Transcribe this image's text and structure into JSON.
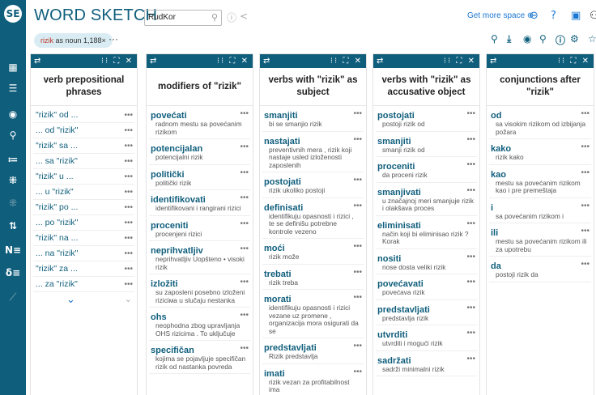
{
  "app": {
    "title": "WORD SKETCH",
    "corpus": "RudKor",
    "get_more_space": "Get more space",
    "query_keyword": "rizik",
    "query_rest": " as noun 1,188×",
    "more_dots": "···"
  },
  "columns": [
    {
      "title": "verb prepositional phrases",
      "rows": [
        "\"rizik\" od ...",
        "... od \"rizik\"",
        "\"rizik\" sa ...",
        "... sa \"rizik\"",
        "\"rizik\" u ...",
        "... u \"rizik\"",
        "\"rizik\" po ...",
        "... po \"rizik\"",
        "\"rizik\" na ...",
        "... na \"rizik\"",
        "\"rizik\" za ...",
        "... za \"rizik\""
      ]
    },
    {
      "title": "modifiers of \"rizik\"",
      "items": [
        {
          "word": "povećati",
          "example": "radnom mestu sa povećanim rizikom"
        },
        {
          "word": "potencijalan",
          "example": "potencijalni rizik"
        },
        {
          "word": "politički",
          "example": "politički rizik"
        },
        {
          "word": "identifikovati",
          "example": "identifikovani i rangirani rizici"
        },
        {
          "word": "proceniti",
          "example": "procenjeni rizici"
        },
        {
          "word": "neprihvatljiv",
          "example": "neprihvatljiv Uopšteno • visoki rizik"
        },
        {
          "word": "izložiti",
          "example": "su zaposleni posebno izloženi riziciма u slučaju nestanka"
        },
        {
          "word": "ohs",
          "example": "neophodna zbog upravljanja OHS rizicima . To uključuje"
        },
        {
          "word": "specifičan",
          "example": "kojima se pojavljuje specifičan rizik od nastanka povreda"
        }
      ]
    },
    {
      "title": "verbs with \"rizik\" as subject",
      "items": [
        {
          "word": "smanjiti",
          "example": "bi se smanjio rizik"
        },
        {
          "word": "nastajati",
          "example": "preventivnih mera , rizik koji nastaje usled izloženosti zaposlenih"
        },
        {
          "word": "postojati",
          "example": "rizik ukoliko postoji"
        },
        {
          "word": "definisati",
          "example": "identifikuju opasnosti i rizici , te se definišu potrebne kontrole vezeno"
        },
        {
          "word": "moći",
          "example": "rizik može"
        },
        {
          "word": "trebati",
          "example": "rizik treba"
        },
        {
          "word": "morati",
          "example": "identifikuju opasnosti i rizici vezane uz promene , organizacija mora osigurati da se"
        },
        {
          "word": "predstavljati",
          "example": "Rizik predstavlja"
        },
        {
          "word": "imati",
          "example": "rizik vezan za profitabilnost ima"
        }
      ]
    },
    {
      "title": "verbs with \"rizik\" as accusative object",
      "items": [
        {
          "word": "postojati",
          "example": "postoji rizik od"
        },
        {
          "word": "smanjiti",
          "example": "smanji rizik od"
        },
        {
          "word": "proceniti",
          "example": "da proceni rizik"
        },
        {
          "word": "smanjivati",
          "example": "u značajnoj meri smanjuje rizik i olakšava proces"
        },
        {
          "word": "eliminisati",
          "example": "način koji bi eliminisao rizik ? Korak"
        },
        {
          "word": "nositi",
          "example": "nose dosta veliki rizik"
        },
        {
          "word": "povećavati",
          "example": "povećava rizik"
        },
        {
          "word": "predstavljati",
          "example": "predstavlja rizik"
        },
        {
          "word": "utvrditi",
          "example": "utvrditi i mogući rizik"
        },
        {
          "word": "sadržati",
          "example": "sadrži minimalni rizik"
        }
      ]
    },
    {
      "title": "conjunctions after \"rizik\"",
      "items": [
        {
          "word": "od",
          "example": "sa visokim rizikom od izbijanja požara"
        },
        {
          "word": "kako",
          "example": "rizik kako"
        },
        {
          "word": "kao",
          "example": "mestu sa povećanim rizikom kao i pre premeštaja"
        },
        {
          "word": "i",
          "example": "sa povećanim rizikom i"
        },
        {
          "word": "ili",
          "example": "mestu sa povećanim rizikom ili za upotrebu"
        },
        {
          "word": "da",
          "example": "postoji rizik da"
        }
      ]
    }
  ]
}
